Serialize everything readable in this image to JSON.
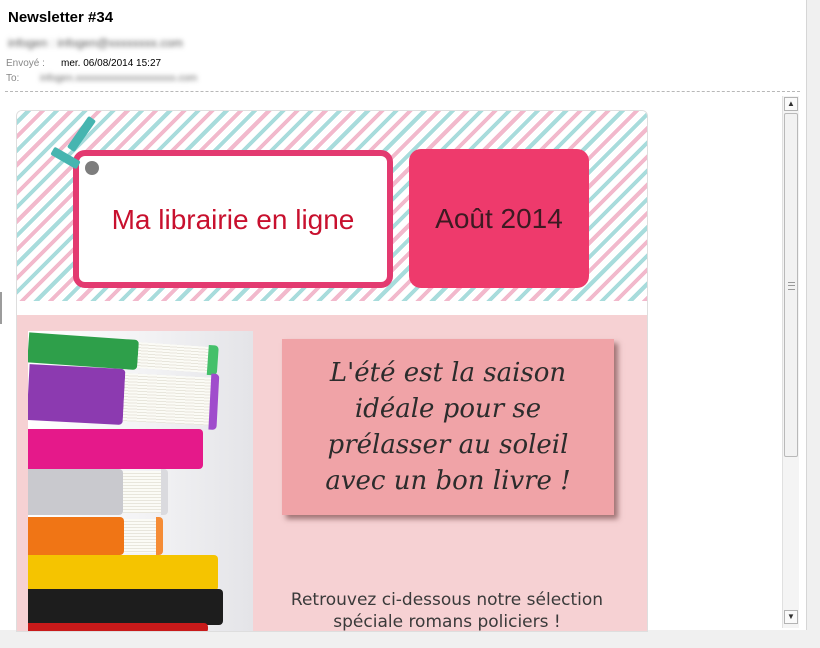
{
  "email": {
    "subject": "Newsletter #34",
    "from_redacted": "infogen : infogen@xxxxxxxx.com",
    "sent_label": "Envoyé :",
    "sent_value": "mer. 06/08/2014 15:27",
    "to_label": "To:",
    "to_redacted": "infogen.xxxxxxxxxxxxxxxxxxxx.com"
  },
  "newsletter": {
    "title": "Ma librairie en ligne",
    "date": "Août 2014",
    "quote": "L'été est la saison idéale pour se prélasser au soleil avec un bon livre !",
    "intro": "Retrouvez ci-dessous notre sélection spéciale romans policiers !"
  },
  "colors": {
    "accent_pink": "#ee3a6c",
    "title_red": "#c8102e",
    "content_bg": "#f6d1d3",
    "quote_bg": "#f0a3a7",
    "ribbon_teal": "#46b5b0"
  },
  "icons": {
    "scroll_up": "▲",
    "scroll_down": "▼"
  }
}
